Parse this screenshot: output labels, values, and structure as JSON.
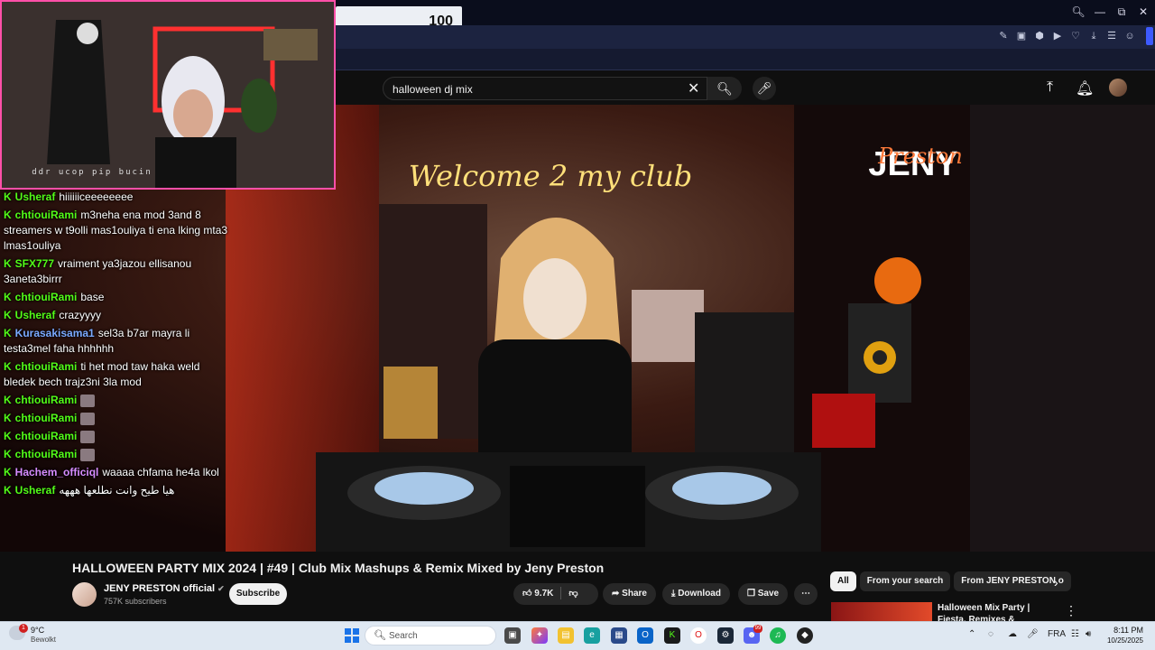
{
  "browser": {
    "volume_value": "100"
  },
  "youtube": {
    "search": {
      "value": "halloween dj mix"
    }
  },
  "stream_overlay": {
    "webcam_caption": "ddr ucop pip bucin",
    "chat": [
      {
        "user": "Usheraf",
        "text": "hiiiiiiceeeeeeee",
        "color": "#53fc18"
      },
      {
        "user": "chtiouiRami",
        "text": "m3neha ena mod 3and 8 streamers w t9olli mas1ouliya ti ena lking mta3 lmas1ouliya",
        "color": "#53fc18"
      },
      {
        "user": "SFX777",
        "text": "vraiment ya3jazou ellisanou 3aneta3birrr",
        "color": "#53fc18"
      },
      {
        "user": "chtiouiRami",
        "text": "base",
        "color": "#53fc18"
      },
      {
        "user": "Usheraf",
        "text": "crazyyyy",
        "color": "#53fc18"
      },
      {
        "user": "Kurasakisama1",
        "text": "sel3a b7ar mayra li testa3mel faha hhhhhh",
        "color": "#7aa9ff"
      },
      {
        "user": "chtiouiRami",
        "text": "ti het mod taw haka weld bledek bech trajz3ni 3la mod",
        "color": "#53fc18"
      },
      {
        "user": "chtiouiRami",
        "text": "",
        "color": "#53fc18"
      },
      {
        "user": "chtiouiRami",
        "text": "",
        "color": "#53fc18"
      },
      {
        "user": "chtiouiRami",
        "text": "",
        "color": "#53fc18"
      },
      {
        "user": "chtiouiRami",
        "text": "",
        "color": "#53fc18"
      },
      {
        "user": "Hachem_officiql",
        "text": "waaaa chfama he4a lkol",
        "color": "#d68cff"
      },
      {
        "user": "Usheraf",
        "text": "هيا طيح وانت نطلعها هههه",
        "color": "#53fc18"
      }
    ]
  },
  "video": {
    "overlay_text": "Welcome 2 my club",
    "logo_top": "JENY",
    "logo_script": "Preston",
    "title": "HALLOWEEN PARTY MIX 2024 | #49 | Club Mix Mashups & Remix Mixed by Jeny Preston",
    "channel": {
      "name": "JENY PRESTON official",
      "subscribers": "757K subscribers",
      "verified": "✔"
    },
    "subscribe_label": "Subscribe",
    "likes": "9.7K",
    "share_label": "Share",
    "download_label": "Download",
    "save_label": "Save"
  },
  "sidebar": {
    "chips": [
      "All",
      "From your search",
      "From JENY PRESTON o"
    ],
    "recommended": {
      "title": "Halloween Mix Party | Fiesta, Remixes & Mashups | Club FD"
    }
  },
  "taskbar": {
    "weather_temp": "9°C",
    "weather_desc": "Bewolkt",
    "weather_badge": "1",
    "search_placeholder": "Search",
    "lang": "FRA",
    "time": "8:11 PM",
    "date": "10/25/2025",
    "discord_badge": "99"
  }
}
